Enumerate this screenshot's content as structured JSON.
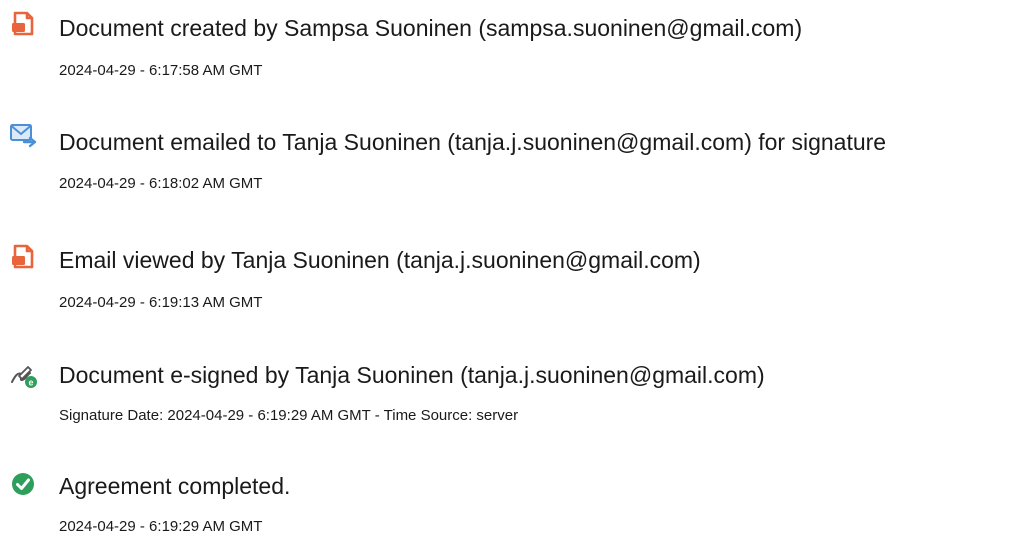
{
  "audit_events": [
    {
      "icon": "document-created-icon",
      "title": "Document created by Sampsa Suoninen (sampsa.suoninen@gmail.com)",
      "timestamp": "2024-04-29 - 6:17:58 AM GMT"
    },
    {
      "icon": "email-sent-icon",
      "title": "Document emailed to Tanja Suoninen (tanja.j.suoninen@gmail.com) for signature",
      "timestamp": "2024-04-29 - 6:18:02 AM GMT"
    },
    {
      "icon": "document-viewed-icon",
      "title": "Email viewed by Tanja Suoninen (tanja.j.suoninen@gmail.com)",
      "timestamp": "2024-04-29 - 6:19:13 AM GMT"
    },
    {
      "icon": "e-sign-icon",
      "title": "Document e-signed by Tanja Suoninen (tanja.j.suoninen@gmail.com)",
      "timestamp": "Signature Date: 2024-04-29 - 6:19:29 AM GMT - Time Source: server"
    },
    {
      "icon": "agreement-complete-icon",
      "title": "Agreement completed.",
      "timestamp": "2024-04-29 - 6:19:29 AM GMT"
    }
  ],
  "colors": {
    "document_icon": "#e8643c",
    "email_icon": "#4a90d9",
    "check_icon": "#2e9e5b",
    "sign_icon": "#2e9e5b",
    "text": "#1a1a1a"
  }
}
